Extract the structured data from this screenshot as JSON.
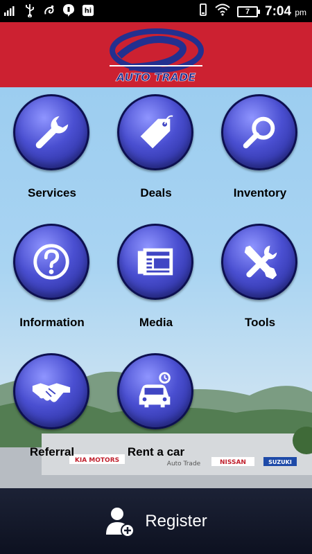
{
  "status_bar": {
    "time": "7:04",
    "ampm": "pm",
    "battery": "7",
    "icons": [
      "signal-icon",
      "usb-icon",
      "uc-browser-icon",
      "hike-icon",
      "hi-icon",
      "vibrate-icon",
      "wifi-icon",
      "battery-icon"
    ]
  },
  "header": {
    "logo_text": "AUTO TRADE",
    "bg_color": "#cc2131"
  },
  "menu": {
    "items": [
      {
        "label": "Services",
        "icon": "wrench-icon"
      },
      {
        "label": "Deals",
        "icon": "tag-icon"
      },
      {
        "label": "Inventory",
        "icon": "magnifier-icon"
      },
      {
        "label": "Information",
        "icon": "question-icon"
      },
      {
        "label": "Media",
        "icon": "newspaper-icon"
      },
      {
        "label": "Tools",
        "icon": "tools-icon"
      },
      {
        "label": "Referral",
        "icon": "handshake-icon"
      },
      {
        "label": "Rent a car",
        "icon": "car-icon"
      }
    ]
  },
  "background": {
    "signs": [
      "KIA MOTORS",
      "Auto Trade",
      "NISSAN",
      "SUZUKI"
    ]
  },
  "register": {
    "label": "Register",
    "icon": "add-user-icon"
  }
}
